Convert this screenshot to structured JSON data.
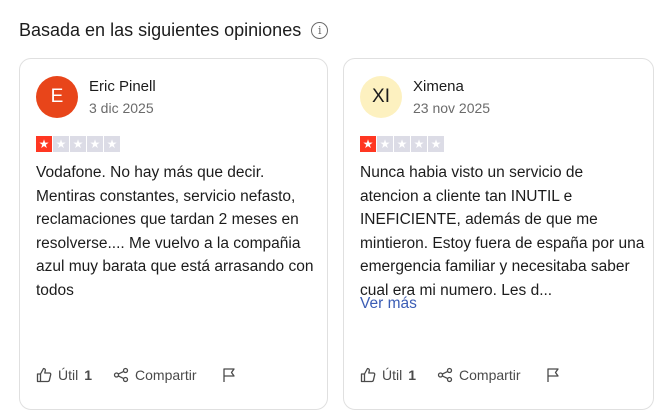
{
  "section": {
    "title": "Basada en las siguientes opiniones",
    "info_symbol": "i"
  },
  "colors": {
    "star_filled": "#ff3722",
    "star_empty": "#dcdce6",
    "link": "#3b5db5"
  },
  "reviews": [
    {
      "author": "Eric Pinell",
      "avatar_text": "E",
      "avatar_bg": "#e8451a",
      "avatar_fg": "#ffffff",
      "date": "3 dic 2025",
      "rating": 1,
      "text": "Vodafone. No hay más que decir. Mentiras constantes, servicio nefasto, reclamaciones que tardan 2 meses en resolverse.... Me vuelvo a la compañia azul muy barata que está arrasando con todos",
      "see_more": "",
      "useful_label": "Útil",
      "useful_count": "1",
      "share_label": "Compartir"
    },
    {
      "author": "Ximena",
      "avatar_text": "XI",
      "avatar_bg": "#fdf1c0",
      "avatar_fg": "#1c1c1c",
      "date": "23 nov 2025",
      "rating": 1,
      "text": "Nunca habia visto un servicio de atencion a cliente tan INUTIL e INEFICIENTE, además de que me mintieron. Estoy fuera de españa por una emergencia familiar y necesitaba saber cual era mi numero. Les d...",
      "see_more": "Ver más",
      "useful_label": "Útil",
      "useful_count": "1",
      "share_label": "Compartir"
    }
  ]
}
